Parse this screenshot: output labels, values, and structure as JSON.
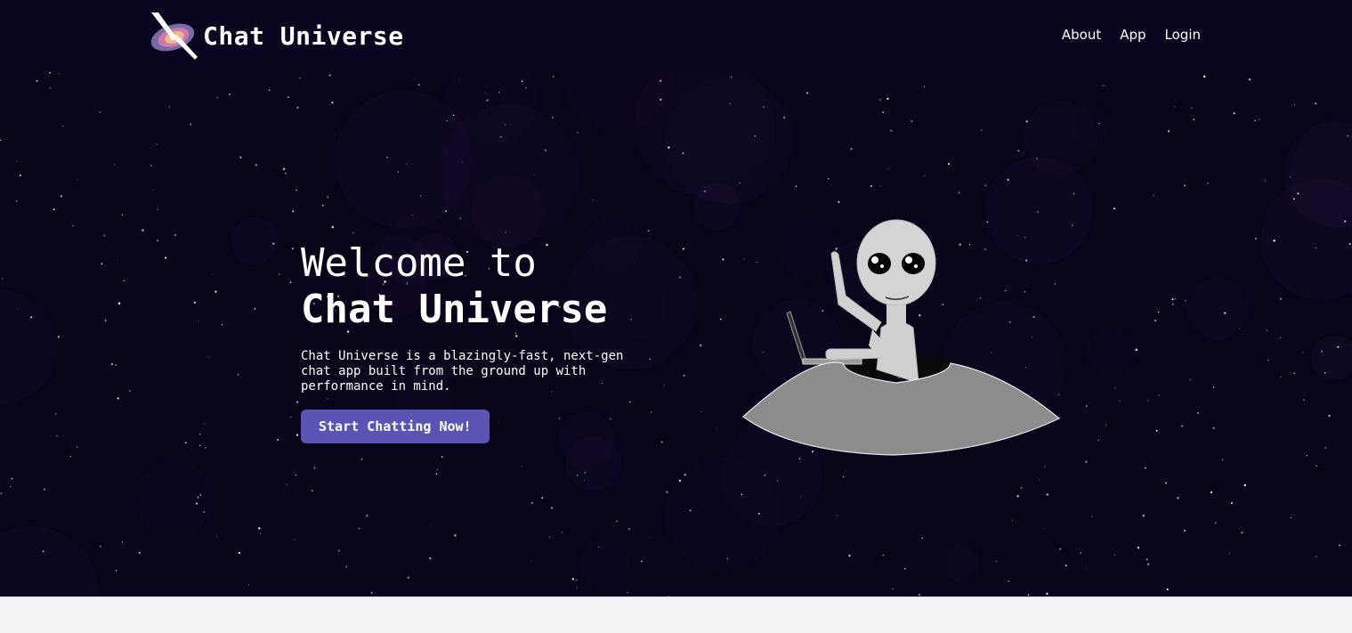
{
  "header": {
    "brand_name": "Chat Universe",
    "logo_icon": "galaxy-rocket-logo",
    "nav": [
      {
        "label": "About"
      },
      {
        "label": "App"
      },
      {
        "label": "Login"
      }
    ]
  },
  "hero": {
    "title_line1": "Welcome to",
    "title_line2": "Chat Universe",
    "description": "Chat Universe is a blazingly-fast, next-gen chat app built from the ground up with performance in mind.",
    "cta_label": "Start Chatting Now!",
    "illustration_icon": "alien-in-ufo-illustration"
  },
  "colors": {
    "background": "#08051a",
    "accent": "#5a55b5",
    "text": "#ffffff",
    "footer": "#f2f2f4"
  }
}
